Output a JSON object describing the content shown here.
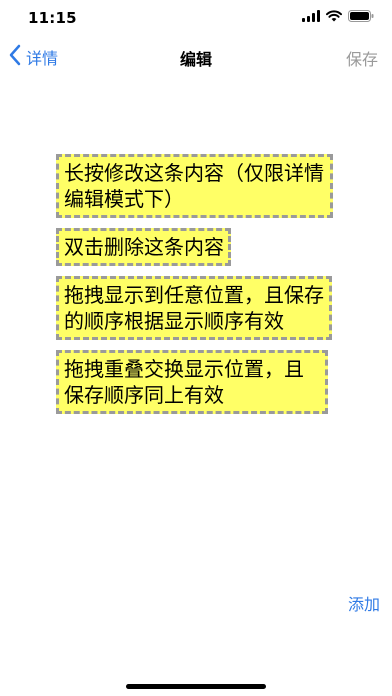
{
  "status_bar": {
    "time": "11:15"
  },
  "nav": {
    "back_label": "详情",
    "title": "编辑",
    "save_label": "保存"
  },
  "notes": [
    "长按修改这条内容（仅限详情编辑模式下）",
    "双击删除这条内容",
    "拖拽显示到任意位置，且保存的顺序根据显示顺序有效",
    "拖拽重叠交换显示位置，且保存顺序同上有效"
  ],
  "add_label": "添加",
  "colors": {
    "accent": "#2f7ae5",
    "note_background": "#ffff66",
    "note_border": "#9a9a9a",
    "disabled_text": "#9a9a9a"
  },
  "icons": {
    "back": "chevron-left-icon",
    "signal": "signal-icon",
    "wifi": "wifi-icon",
    "battery": "battery-icon"
  }
}
